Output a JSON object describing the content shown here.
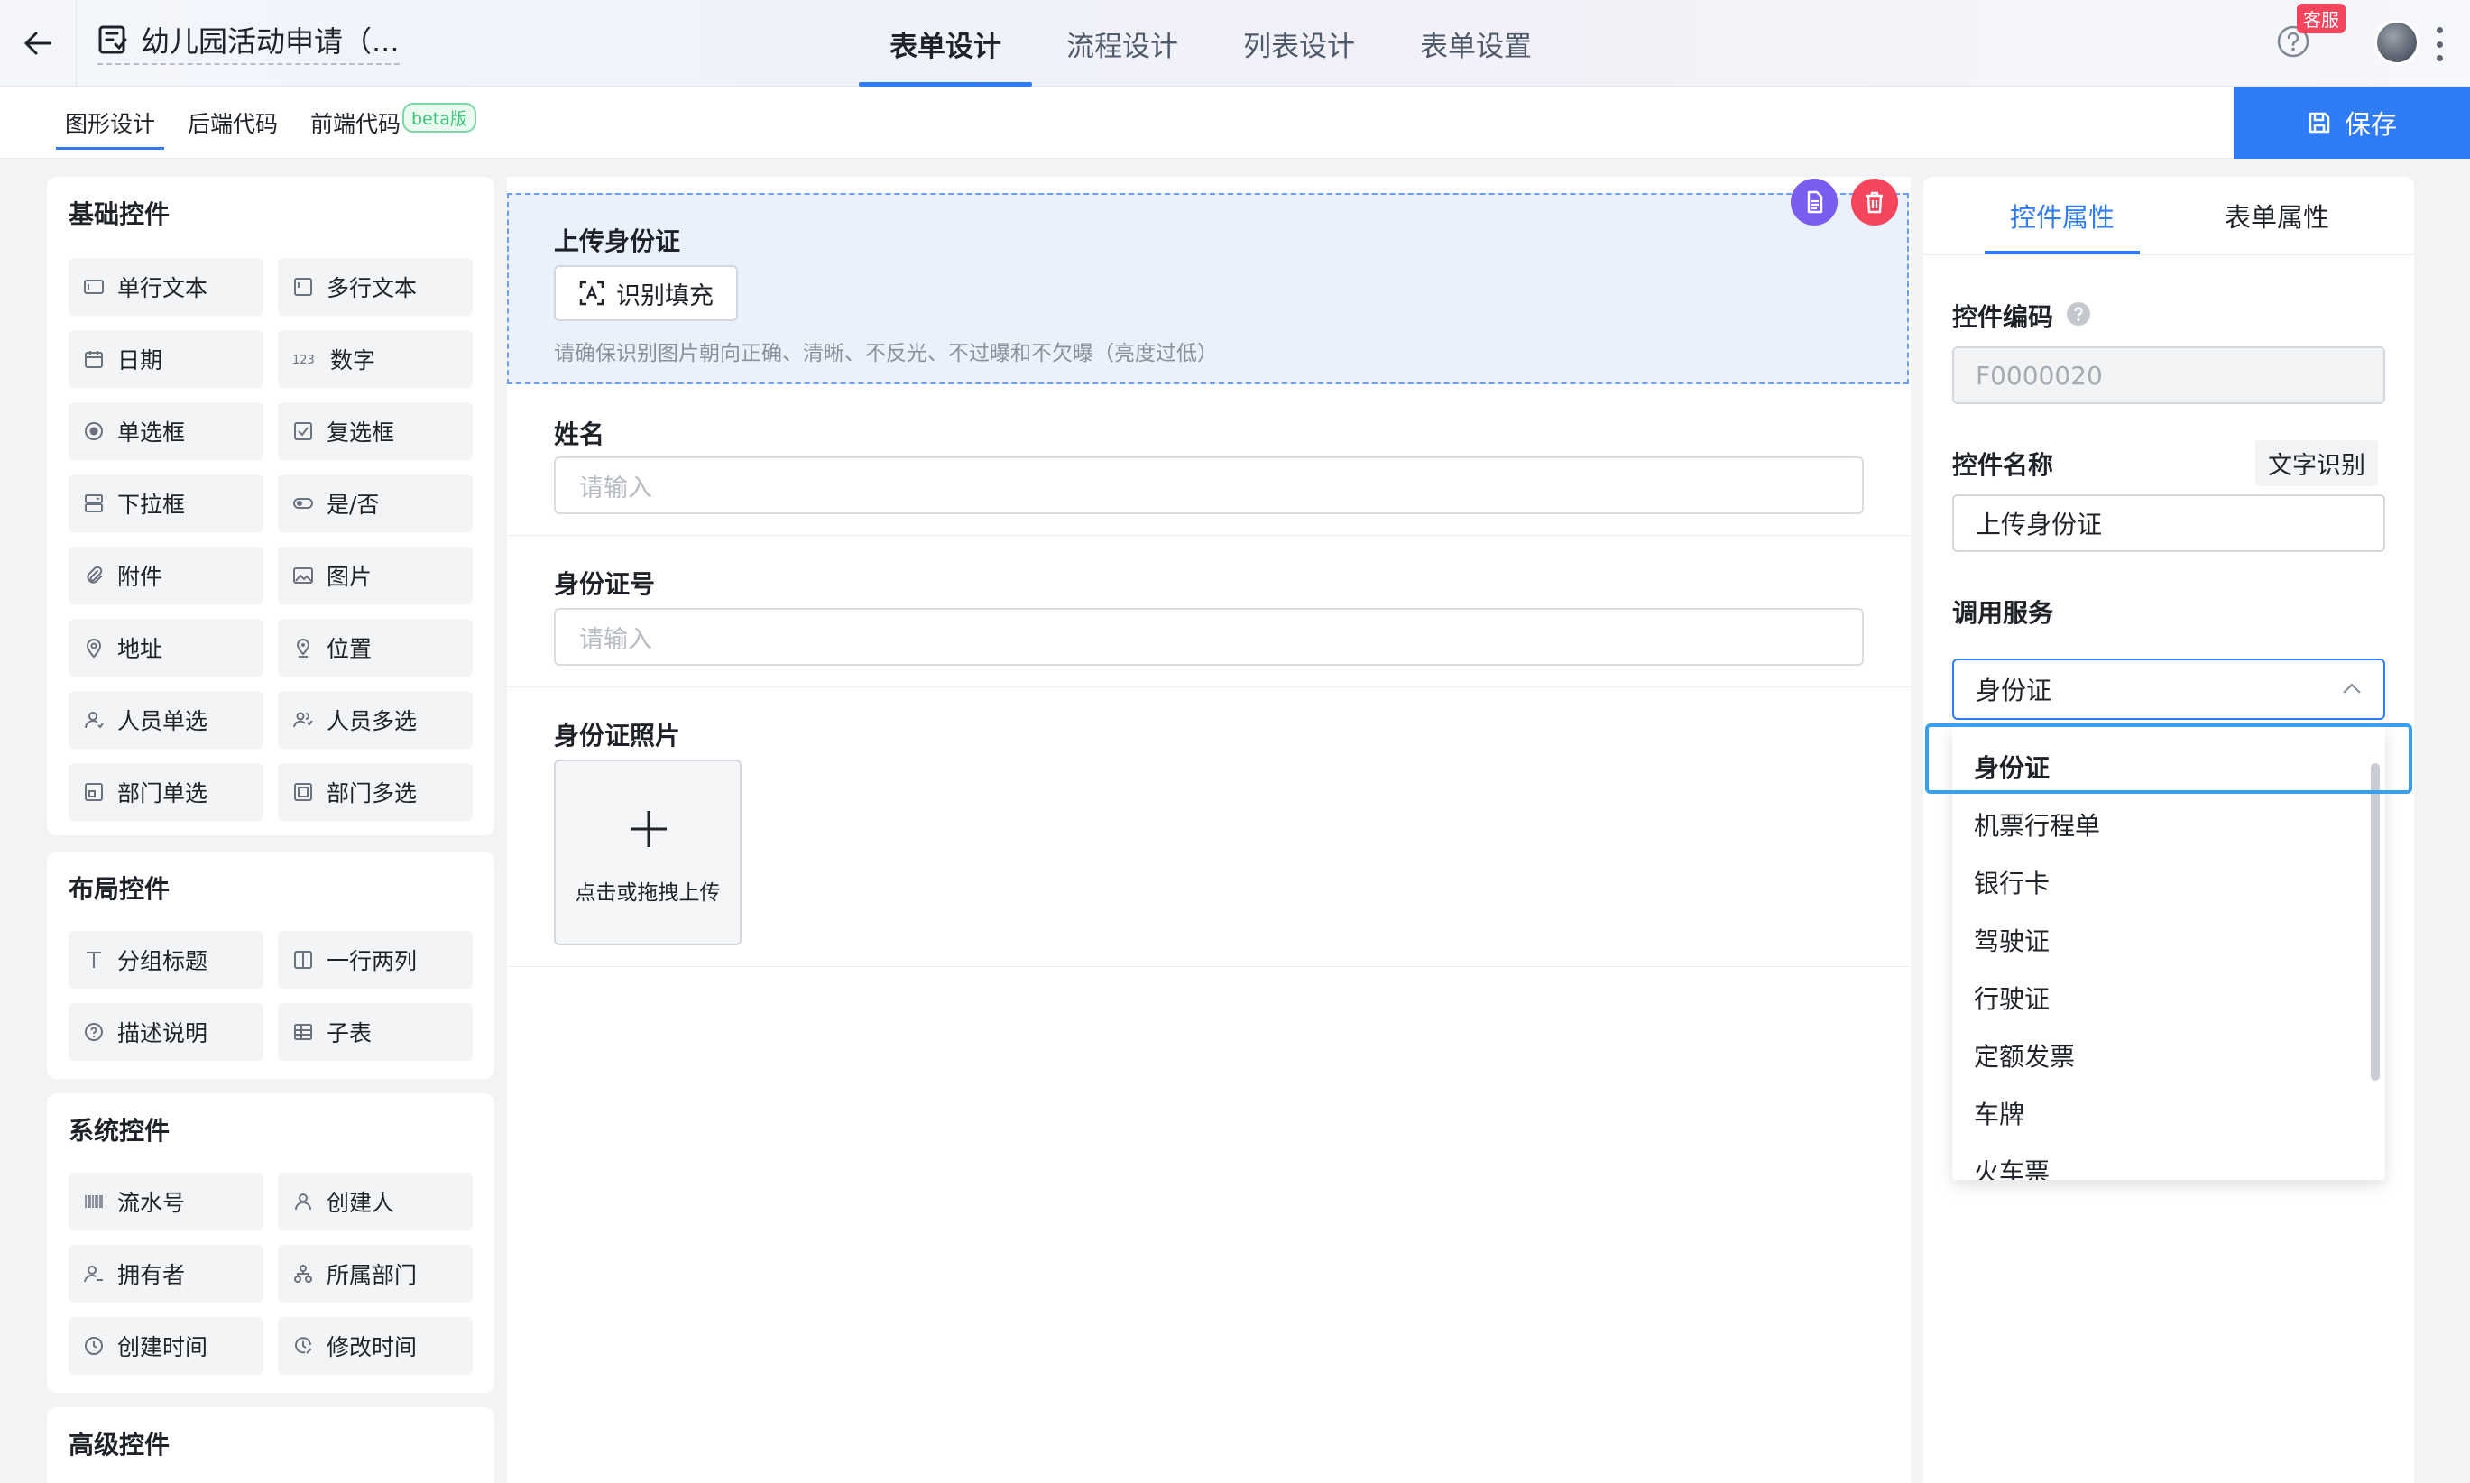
{
  "header": {
    "app_title": "幼儿园活动申请（...",
    "tabs": [
      {
        "label": "表单设计",
        "active": true
      },
      {
        "label": "流程设计",
        "active": false
      },
      {
        "label": "列表设计",
        "active": false
      },
      {
        "label": "表单设置",
        "active": false
      }
    ],
    "service_badge": "客服"
  },
  "subbar": {
    "tabs": [
      {
        "label": "图形设计",
        "active": true
      },
      {
        "label": "后端代码",
        "active": false
      },
      {
        "label": "前端代码",
        "active": false
      }
    ],
    "beta_label": "beta版",
    "save_label": "保存"
  },
  "left_panel": {
    "basic": {
      "title": "基础控件",
      "items": [
        {
          "label": "单行文本",
          "icon": "single-line-text-icon"
        },
        {
          "label": "多行文本",
          "icon": "multi-line-text-icon"
        },
        {
          "label": "日期",
          "icon": "calendar-icon"
        },
        {
          "label": "数字",
          "icon": "number-icon"
        },
        {
          "label": "单选框",
          "icon": "radio-icon"
        },
        {
          "label": "复选框",
          "icon": "checkbox-icon"
        },
        {
          "label": "下拉框",
          "icon": "dropdown-icon"
        },
        {
          "label": "是/否",
          "icon": "toggle-icon"
        },
        {
          "label": "附件",
          "icon": "paperclip-icon"
        },
        {
          "label": "图片",
          "icon": "image-icon"
        },
        {
          "label": "地址",
          "icon": "map-pin-icon"
        },
        {
          "label": "位置",
          "icon": "location-icon"
        },
        {
          "label": "人员单选",
          "icon": "user-icon"
        },
        {
          "label": "人员多选",
          "icon": "users-icon"
        },
        {
          "label": "部门单选",
          "icon": "department-icon"
        },
        {
          "label": "部门多选",
          "icon": "departments-icon"
        }
      ]
    },
    "layout": {
      "title": "布局控件",
      "items": [
        {
          "label": "分组标题",
          "icon": "text-title-icon"
        },
        {
          "label": "一行两列",
          "icon": "two-column-icon"
        },
        {
          "label": "描述说明",
          "icon": "help-circle-icon"
        },
        {
          "label": "子表",
          "icon": "table-icon"
        }
      ]
    },
    "system": {
      "title": "系统控件",
      "items": [
        {
          "label": "流水号",
          "icon": "barcode-icon"
        },
        {
          "label": "创建人",
          "icon": "user-icon"
        },
        {
          "label": "拥有者",
          "icon": "owner-icon"
        },
        {
          "label": "所属部门",
          "icon": "org-icon"
        },
        {
          "label": "创建时间",
          "icon": "clock-icon"
        },
        {
          "label": "修改时间",
          "icon": "clock-edit-icon"
        }
      ]
    },
    "advanced": {
      "title": "高级控件"
    }
  },
  "canvas": {
    "upload_id": {
      "label": "上传身份证",
      "button_label": "识别填充",
      "hint": "请确保识别图片朝向正确、清晰、不反光、不过曝和不欠曝（亮度过低）"
    },
    "name": {
      "label": "姓名",
      "placeholder": "请输入"
    },
    "id_number": {
      "label": "身份证号",
      "placeholder": "请输入"
    },
    "id_photo": {
      "label": "身份证照片",
      "upload_text": "点击或拖拽上传"
    }
  },
  "right_panel": {
    "tabs": [
      {
        "label": "控件属性",
        "active": true
      },
      {
        "label": "表单属性",
        "active": false
      }
    ],
    "code_label": "控件编码",
    "code_value": "F0000020",
    "name_label": "控件名称",
    "ocr_tag": "文字识别",
    "name_value": "上传身份证",
    "service_label": "调用服务",
    "service_value": "身份证",
    "options": [
      "身份证",
      "机票行程单",
      "银行卡",
      "驾驶证",
      "行驶证",
      "定额发票",
      "车牌",
      "火车票"
    ]
  },
  "colors": {
    "accent": "#2f7cf6",
    "selected_bg": "#eaf1fc",
    "danger": "#f5455c",
    "copy_button": "#7a5cf0",
    "highlight_border": "#3aa0ee"
  }
}
